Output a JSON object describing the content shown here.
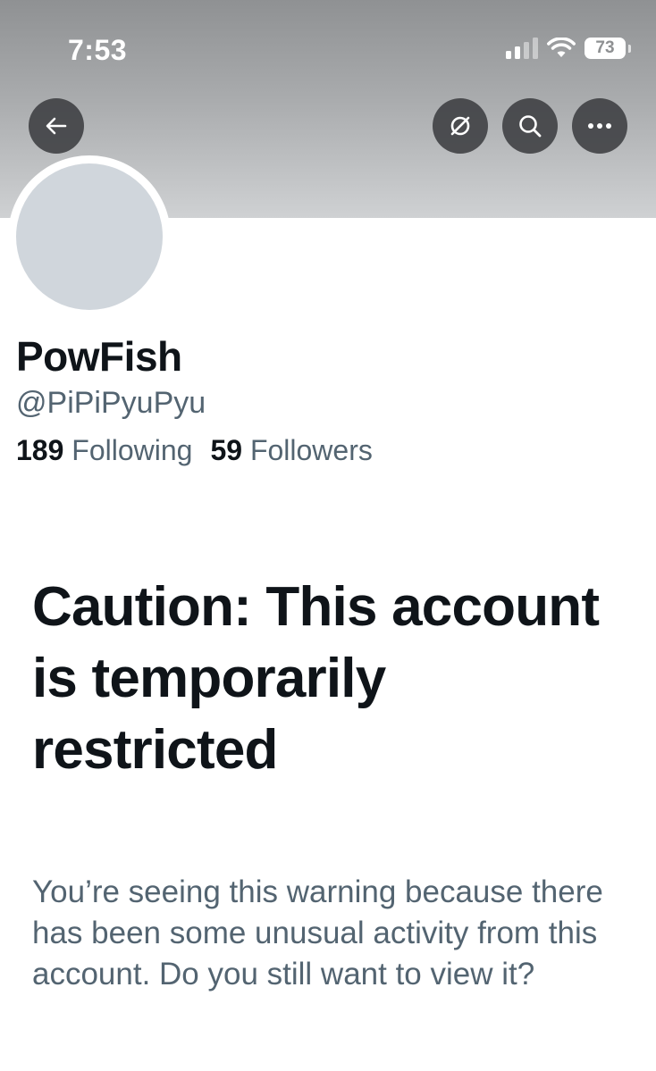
{
  "status_bar": {
    "time": "7:53",
    "battery": "73",
    "icons": [
      "cellular-signal-icon",
      "wifi-icon",
      "battery-icon"
    ]
  },
  "header": {
    "icons": {
      "back": "back-arrow-icon",
      "translate": "no-translate-icon",
      "search": "search-icon",
      "more": "more-options-icon"
    }
  },
  "profile": {
    "display_name": "PowFish",
    "handle": "@PiPiPyuPyu",
    "following_count": "189",
    "following_label": "Following",
    "followers_count": "59",
    "followers_label": "Followers"
  },
  "warning": {
    "title": "Caution: This account is temporarily restricted",
    "body": "You’re seeing this warning because there has been some unusual activity from this account. Do you still want to view it?"
  },
  "colors": {
    "primary_text": "#0f1419",
    "secondary_text": "#536471",
    "avatar_placeholder": "#d0d6dc",
    "button_bg": "#3c3e41"
  }
}
